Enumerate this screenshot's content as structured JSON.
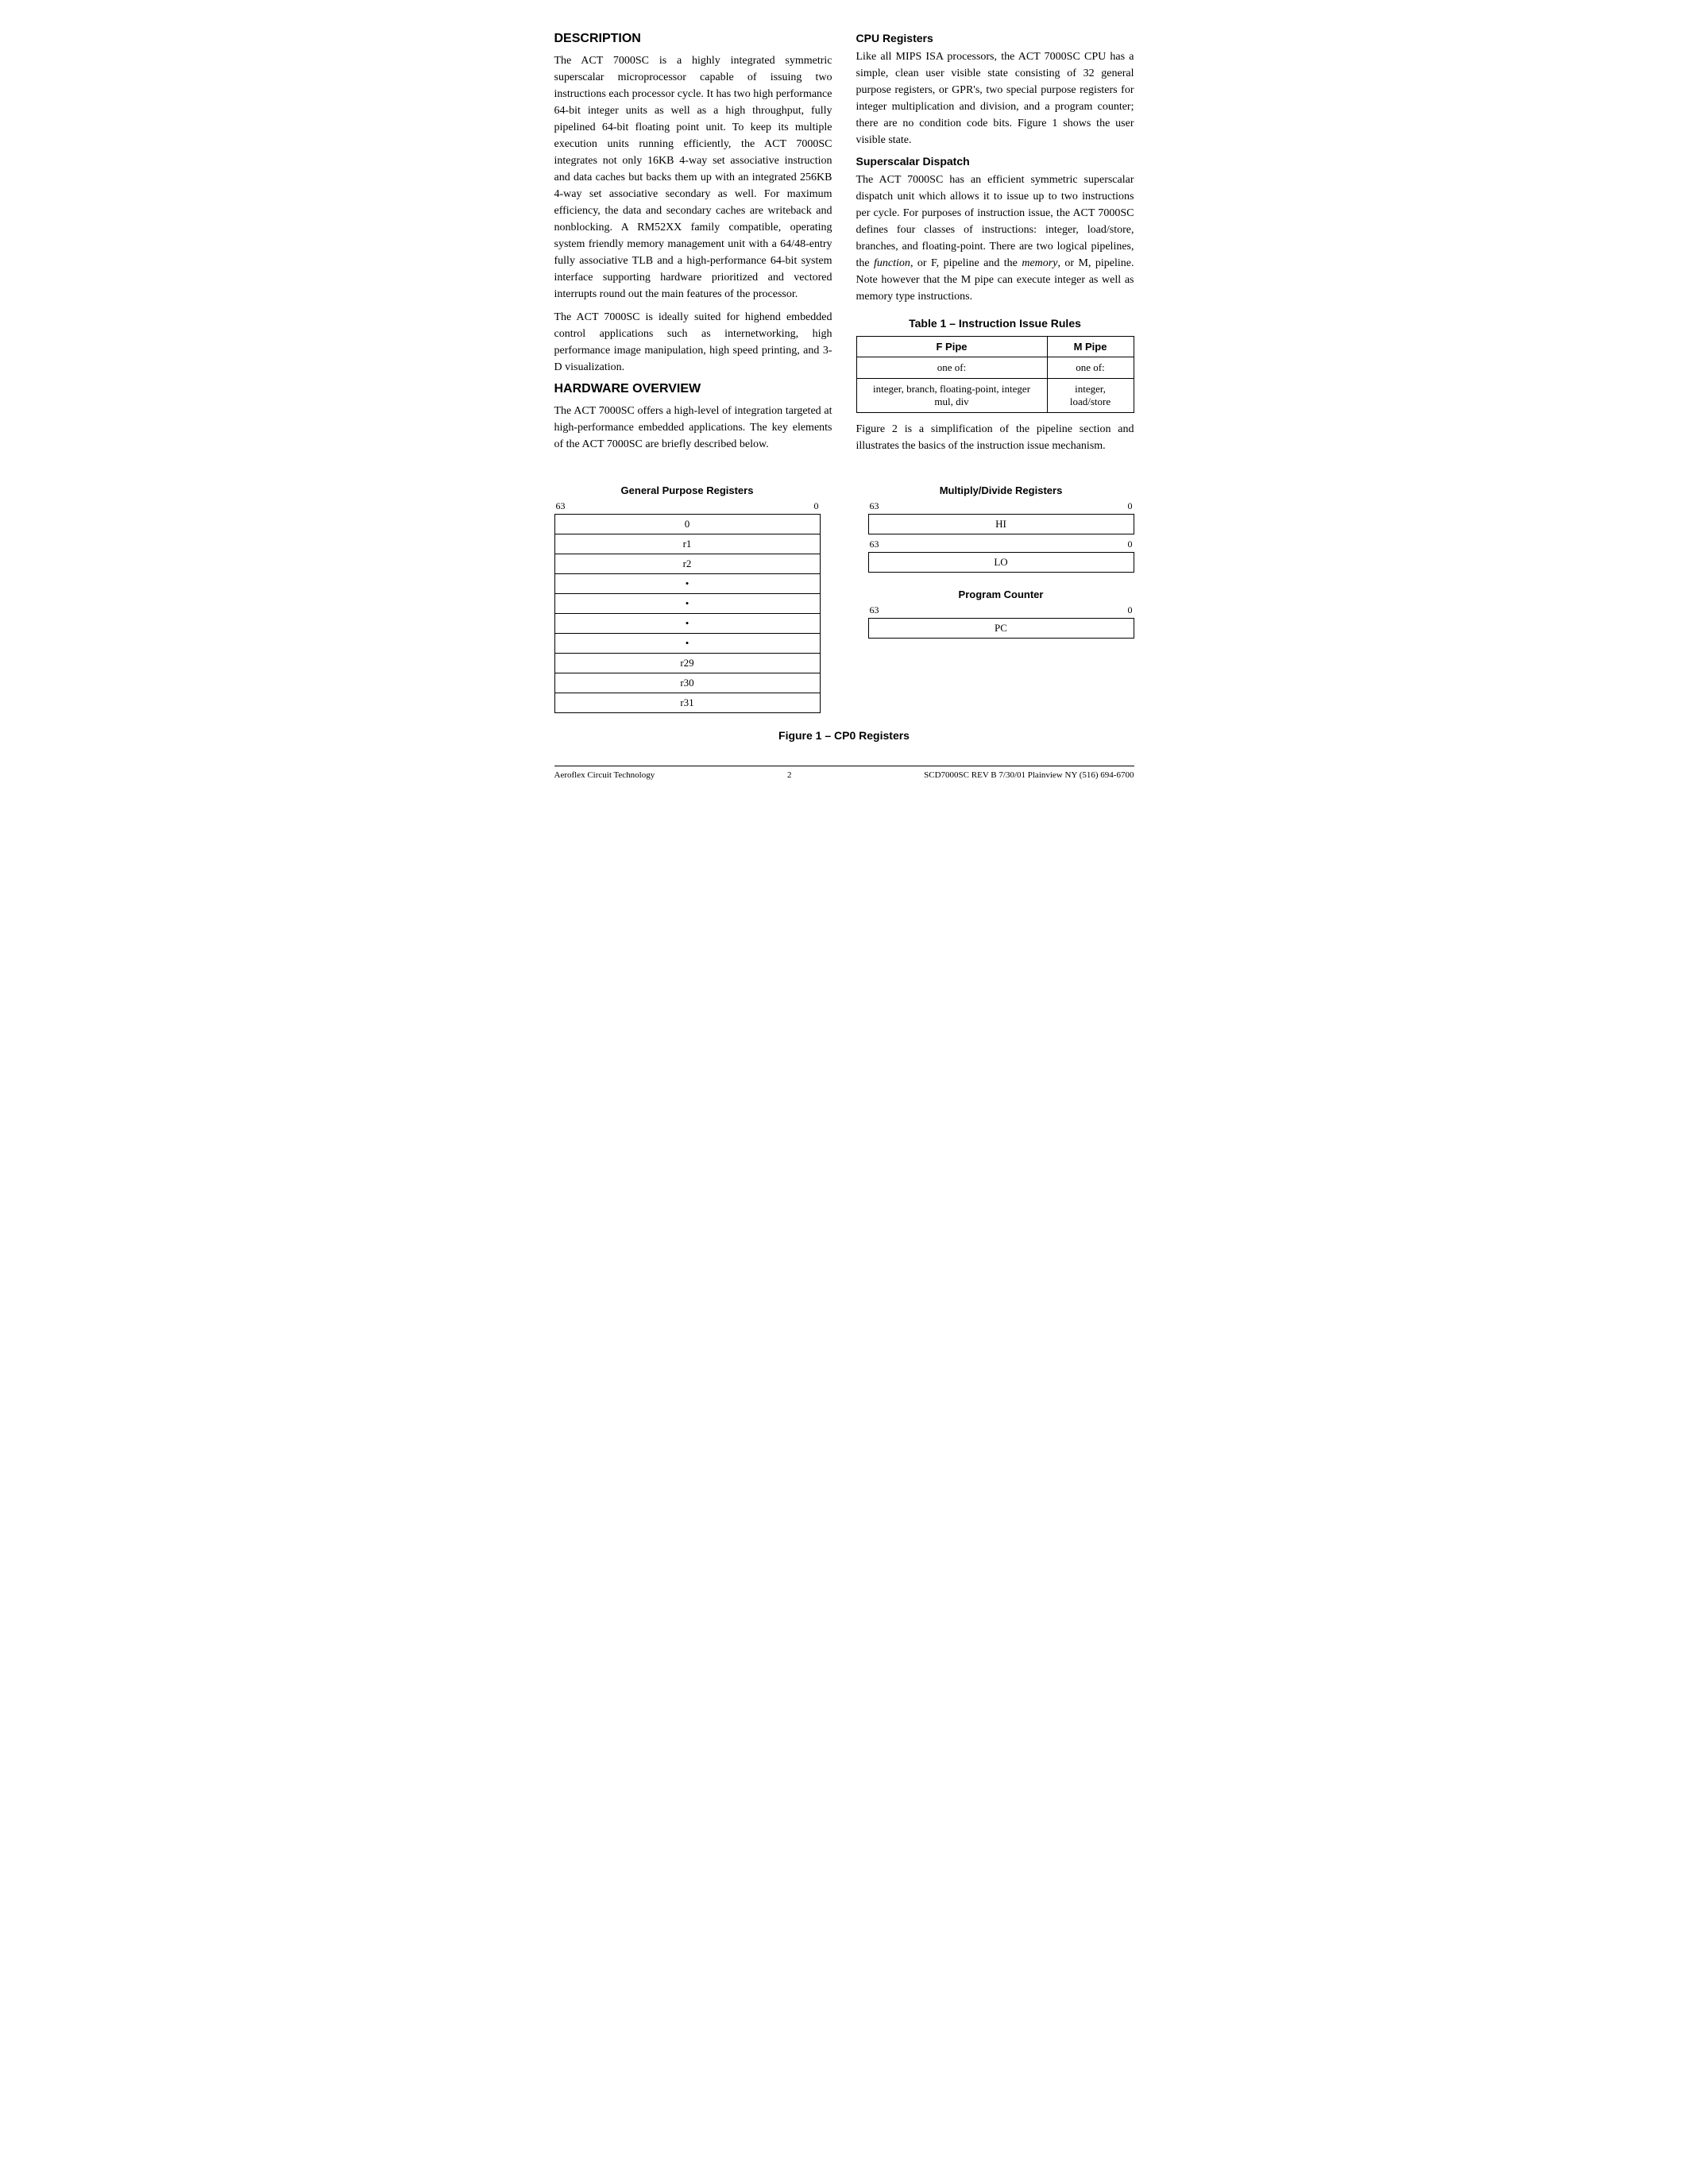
{
  "page": {
    "sections": {
      "description": {
        "title": "Description",
        "paragraphs": [
          "The ACT 7000SC is a highly integrated symmetric superscalar microprocessor capable of issuing two instructions each processor cycle. It has two high performance 64-bit integer units as well as a high throughput, fully pipelined 64-bit floating point unit. To keep its multiple execution units running efficiently, the ACT 7000SC integrates not only 16KB 4-way set associative instruction and data caches but backs them up with an integrated 256KB 4-way set associative secondary as well. For maximum efficiency, the data and secondary caches are writeback and nonblocking. A RM52XX family compatible, operating system friendly memory management unit with a 64/48-entry fully associative TLB and a high-performance 64-bit system interface supporting hardware prioritized and vectored interrupts round out the main features of the processor.",
          "The ACT 7000SC is ideally suited for highend embedded control applications such as internetworking, high performance image manipulation, high speed printing, and 3-D visualization."
        ]
      },
      "hardware_overview": {
        "title": "Hardware Overview",
        "paragraph": "The ACT 7000SC offers a high-level of integration targeted at high-performance embedded applications. The key elements of the ACT 7000SC are briefly described below."
      },
      "cpu_registers": {
        "title": "CPU Registers",
        "paragraph": "Like all MIPS ISA processors, the ACT 7000SC CPU has a simple, clean user visible state consisting of 32 general purpose registers, or GPR's, two special purpose registers for integer multiplication and division, and a program counter; there are no condition code bits. Figure 1 shows the user visible state."
      },
      "superscalar_dispatch": {
        "title": "Superscalar Dispatch",
        "paragraph": "The ACT 7000SC has an efficient symmetric superscalar dispatch unit which allows it to issue up to two instructions per cycle. For purposes of instruction issue, the ACT 7000SC defines four classes of instructions: integer, load/store, branches, and floating-point. There are two logical pipelines, the function, or F, pipeline and the memory, or M, pipeline. Note however that the M pipe can execute integer as well as memory type instructions."
      },
      "table1": {
        "title": "Table 1 – Instruction Issue Rules",
        "headers": [
          "F Pipe",
          "M Pipe"
        ],
        "rows": [
          [
            "one of:",
            "one of:"
          ],
          [
            "integer, branch, floating-point, integer mul, div",
            "integer, load/store"
          ]
        ]
      },
      "figure_paragraph": "Figure 2 is a simplification of the pipeline section and illustrates the basics of the instruction issue mechanism.",
      "figure": {
        "caption": "Figure 1 – CP0 Registers",
        "gpr": {
          "title": "General Purpose Registers",
          "bit_high": "63",
          "bit_low": "0",
          "rows": [
            "0",
            "r1",
            "r2",
            "•",
            "•",
            "•",
            "•",
            "r29",
            "r30",
            "r31"
          ]
        },
        "multiply_divide": {
          "title": "Multiply/Divide Registers",
          "registers": [
            {
              "bit_high": "63",
              "bit_low": "0",
              "label": "HI"
            },
            {
              "bit_high": "63",
              "bit_low": "0",
              "label": "LO"
            }
          ]
        },
        "program_counter": {
          "title": "Program Counter",
          "bit_high": "63",
          "bit_low": "0",
          "label": "PC"
        }
      }
    },
    "footer": {
      "left": "Aeroflex Circuit Technology",
      "center": "2",
      "right": "SCD7000SC REV B  7/30/01  Plainview NY (516) 694-6700"
    }
  }
}
